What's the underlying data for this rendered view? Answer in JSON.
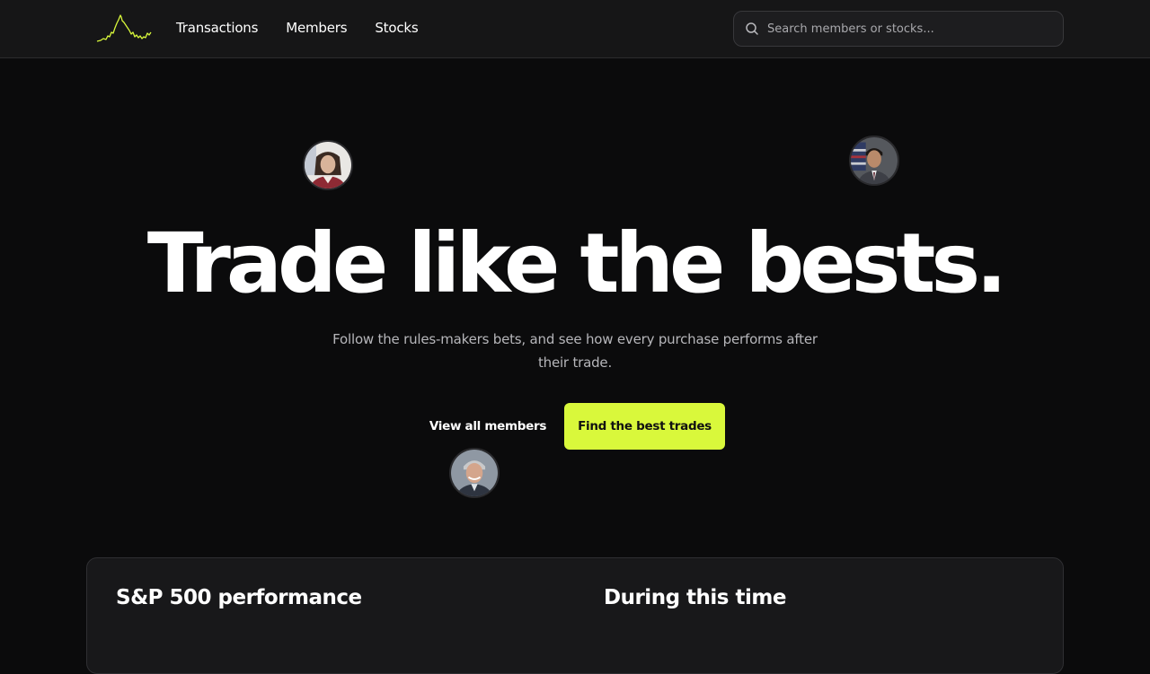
{
  "header": {
    "logo_icon": "stock-spark-logo",
    "accent_color": "#d9f83b",
    "nav": [
      {
        "label": "Transactions"
      },
      {
        "label": "Members"
      },
      {
        "label": "Stocks"
      }
    ],
    "search": {
      "placeholder": "Search members or stocks...",
      "value": "",
      "icon": "search-icon"
    }
  },
  "hero": {
    "title": "Trade like the bests.",
    "subtitle": "Follow the rules-makers bets, and see how every purchase performs after their trade.",
    "secondary_button": "View all members",
    "primary_button": "Find the best trades",
    "avatars": [
      "member-avatar-woman",
      "member-avatar-man-flag",
      "member-avatar-man-gray-hair"
    ]
  },
  "performance_card": {
    "left_title": "S&P 500 performance",
    "right_title": "During this time"
  }
}
